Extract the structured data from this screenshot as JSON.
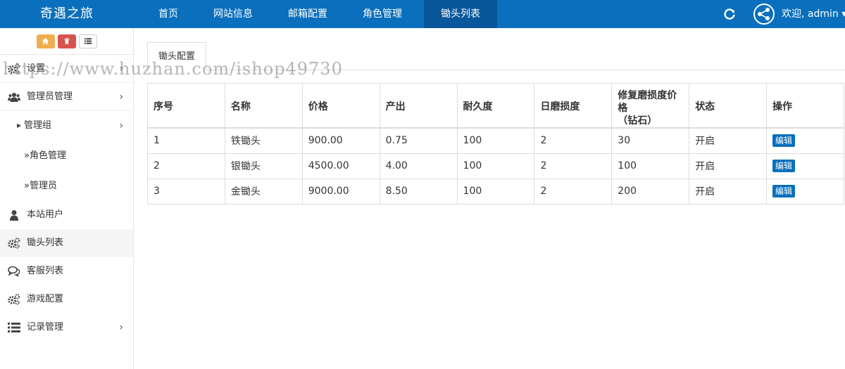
{
  "app": {
    "title": "奇遇之旅"
  },
  "nav": {
    "items": [
      {
        "label": "首页"
      },
      {
        "label": "网站信息"
      },
      {
        "label": "邮箱配置"
      },
      {
        "label": "角色管理"
      },
      {
        "label": "锄头列表"
      }
    ],
    "active": "锄头列表",
    "welcome": "欢迎, admin ▾"
  },
  "watermark": "https://www.huzhan.com/ishop49730",
  "sidebar": {
    "items": [
      {
        "label": "设置",
        "icon": "gears-icon"
      },
      {
        "label": "管理员管理",
        "icon": "users-icon"
      },
      {
        "label": "管理组"
      },
      {
        "label": "»角色管理"
      },
      {
        "label": "»管理员"
      },
      {
        "label": "本站用户",
        "icon": "user-icon"
      },
      {
        "label": "锄头列表",
        "icon": "gears-icon"
      },
      {
        "label": "客服列表",
        "icon": "comments-icon"
      },
      {
        "label": "游戏配置",
        "icon": "gears-icon"
      },
      {
        "label": "记录管理",
        "icon": "list-icon"
      }
    ]
  },
  "main": {
    "tab": "锄头配置",
    "table": {
      "headers": [
        "序号",
        "名称",
        "价格",
        "产出",
        "耐久度",
        "日磨损度",
        "修复磨损度价格（钻石）",
        "状态",
        "操作"
      ],
      "header_repair_line1": "修复磨损度价格",
      "header_repair_line2": "（钻石）",
      "edit_label": "编辑",
      "rows": [
        [
          "1",
          "铁锄头",
          "900.00",
          "0.75",
          "100",
          "2",
          "30",
          "开启"
        ],
        [
          "2",
          "银锄头",
          "4500.00",
          "4.00",
          "100",
          "2",
          "100",
          "开启"
        ],
        [
          "3",
          "金锄头",
          "9000.00",
          "8.50",
          "100",
          "2",
          "200",
          "开启"
        ]
      ]
    }
  },
  "colors": {
    "primary": "#0a6fbc",
    "nav_active": "#07579a",
    "orange": "#f0ad4e",
    "red": "#d9534f"
  }
}
